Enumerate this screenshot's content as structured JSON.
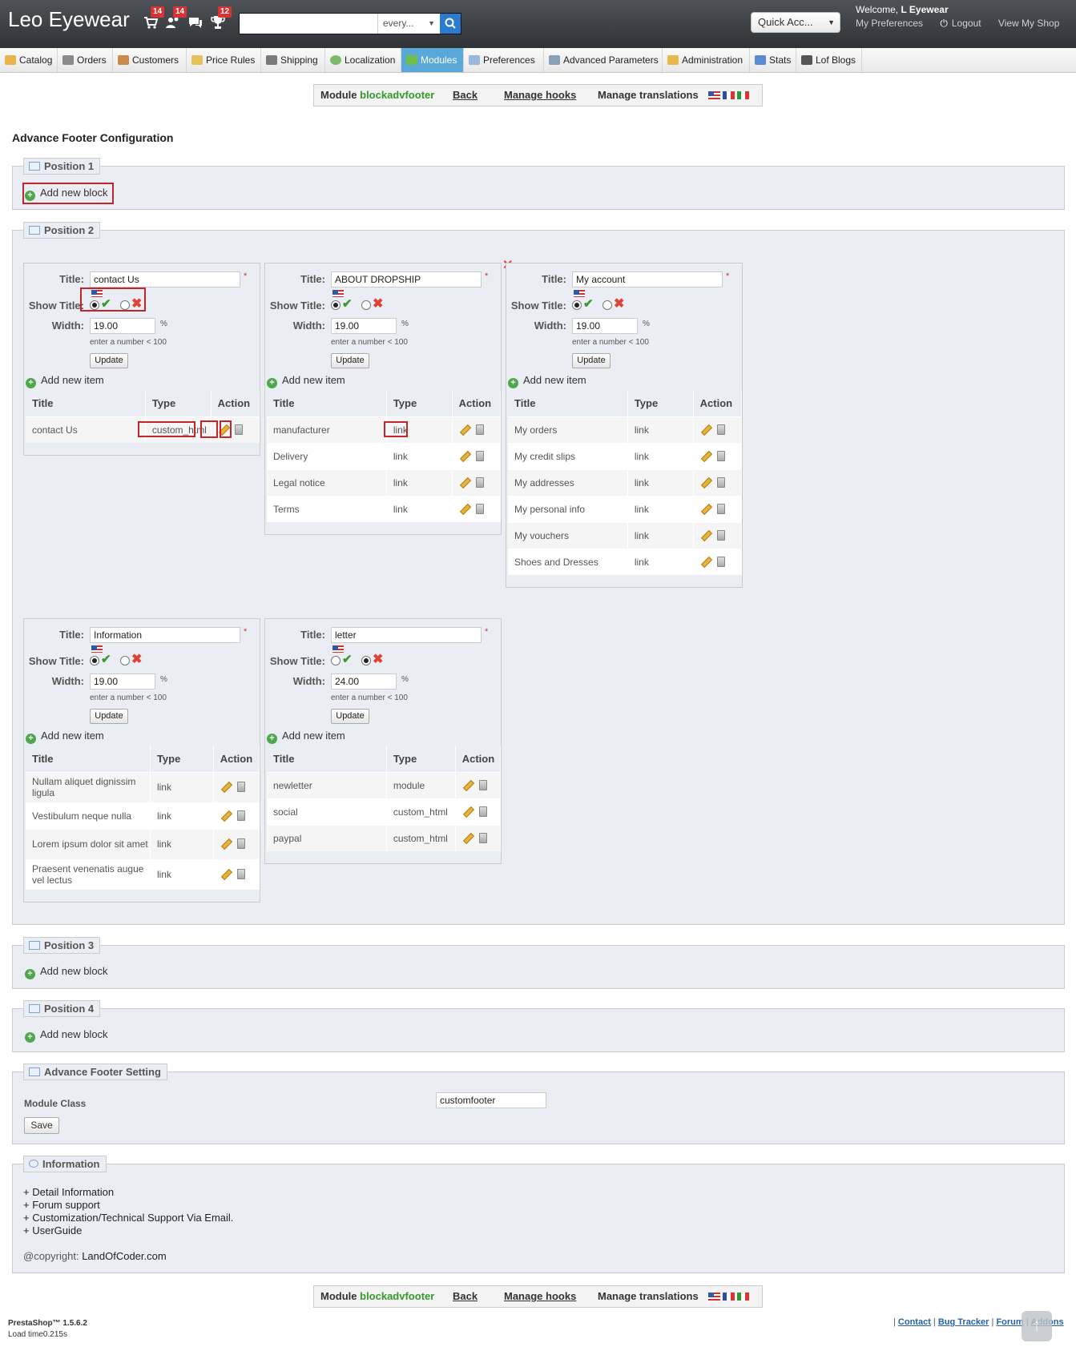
{
  "app": {
    "logo": "Leo Eyewear"
  },
  "header": {
    "badges": [
      "14",
      "14",
      "12"
    ],
    "search_scope": "every...",
    "quick_access": "Quick Acc...",
    "welcome_prefix": "Welcome,",
    "welcome_user": "L Eyewear",
    "links": [
      "My Preferences",
      "Logout",
      "View My Shop"
    ]
  },
  "nav": {
    "tabs": [
      "Catalog",
      "Orders",
      "Customers",
      "Price Rules",
      "Shipping",
      "Localization",
      "Modules",
      "Preferences",
      "Advanced Parameters",
      "Administration",
      "Stats",
      "Lof Blogs"
    ],
    "active": "Modules"
  },
  "modbar": {
    "module_prefix": "Module",
    "module_name": "blockadvfooter",
    "back": "Back",
    "hooks": "Manage hooks",
    "translations": "Manage translations"
  },
  "page_title": "Advance Footer Configuration",
  "positions": [
    "Position 1",
    "Position 2",
    "Position 3",
    "Position 4"
  ],
  "add_block": "Add new block",
  "labels": {
    "title": "Title:",
    "show_title": "Show Title:",
    "width": "Width:",
    "percent": "%",
    "hint": "enter a number < 100",
    "update": "Update",
    "add_item": "Add new item",
    "col_title": "Title",
    "col_type": "Type",
    "col_action": "Action",
    "required": "*"
  },
  "blocks": [
    {
      "title": "contact Us",
      "show": true,
      "width": "19.00",
      "items": [
        [
          "contact Us",
          "custom_html"
        ]
      ]
    },
    {
      "title": "ABOUT DROPSHIP",
      "show": true,
      "width": "19.00",
      "items": [
        [
          "manufacturer",
          "link"
        ],
        [
          "Delivery",
          "link"
        ],
        [
          "Legal notice",
          "link"
        ],
        [
          "Terms",
          "link"
        ]
      ]
    },
    {
      "title": "My account",
      "show": true,
      "width": "19.00",
      "items": [
        [
          "My orders",
          "link"
        ],
        [
          "My credit slips",
          "link"
        ],
        [
          "My addresses",
          "link"
        ],
        [
          "My personal info",
          "link"
        ],
        [
          "My vouchers",
          "link"
        ],
        [
          "Shoes and Dresses",
          "link"
        ]
      ]
    },
    {
      "title": "Information",
      "show": true,
      "width": "19.00",
      "items": [
        [
          "Nullam aliquet dignissim ligula",
          "link"
        ],
        [
          "Vestibulum neque nulla",
          "link"
        ],
        [
          "Lorem ipsum dolor sit amet",
          "link"
        ],
        [
          "Praesent venenatis augue vel lectus",
          "link"
        ]
      ]
    },
    {
      "title": "letter",
      "show": false,
      "width": "24.00",
      "items": [
        [
          "newletter",
          "module"
        ],
        [
          "social",
          "custom_html"
        ],
        [
          "paypal",
          "custom_html"
        ]
      ]
    }
  ],
  "setting": {
    "legend": "Advance Footer Setting",
    "module_class_label": "Module Class",
    "module_class_value": "customfooter",
    "save": "Save"
  },
  "info": {
    "legend": "Information",
    "lines": [
      "+ Detail Information",
      "+ Forum support",
      "+ Customization/Technical Support Via Email.",
      "+ UserGuide"
    ],
    "copyright_label": "@copyright:",
    "copyright_value": "LandOfCoder.com"
  },
  "footer": {
    "version": "PrestaShop™ 1.5.6.2",
    "load": "Load time0.215s",
    "links": [
      "Contact",
      "Bug Tracker",
      "Forum",
      "Addons"
    ]
  },
  "colors": {
    "header": "#3a3d41",
    "active_tab": "#5aa8d8",
    "accent_green": "#339a2a",
    "highlight": "#c0262c",
    "panel": "#ebedf4"
  }
}
